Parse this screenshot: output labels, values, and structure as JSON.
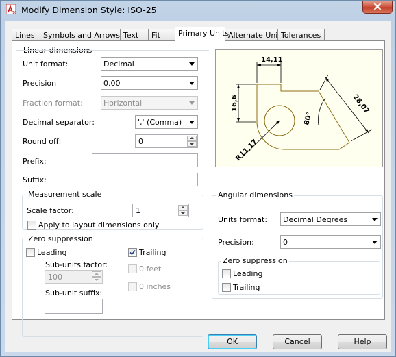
{
  "window": {
    "title": "Modify Dimension Style: ISO-25"
  },
  "tabs": [
    {
      "label": "Lines",
      "active": false
    },
    {
      "label": "Symbols and Arrows",
      "active": false
    },
    {
      "label": "Text",
      "active": false
    },
    {
      "label": "Fit",
      "active": false
    },
    {
      "label": "Primary Units",
      "active": true
    },
    {
      "label": "Alternate Units",
      "active": false
    },
    {
      "label": "Tolerances",
      "active": false
    }
  ],
  "linear": {
    "legend": "Linear dimensions",
    "unit_format": {
      "label": "Unit format:",
      "value": "Decimal"
    },
    "precision": {
      "label": "Precision",
      "value": "0.00"
    },
    "fraction_format": {
      "label": "Fraction format:",
      "value": "Horizontal",
      "disabled": true
    },
    "decimal_separator": {
      "label": "Decimal separator:",
      "value": "',' (Comma)"
    },
    "round_off": {
      "label": "Round off:",
      "value": "0"
    },
    "prefix": {
      "label": "Prefix:",
      "value": ""
    },
    "suffix": {
      "label": "Suffix:",
      "value": ""
    }
  },
  "measurement": {
    "legend": "Measurement scale",
    "scale_factor": {
      "label": "Scale factor:",
      "value": "1"
    },
    "apply_layout": {
      "label": "Apply to layout dimensions only",
      "checked": false
    }
  },
  "zero_suppression": {
    "legend": "Zero suppression",
    "leading": {
      "label": "Leading",
      "checked": false
    },
    "trailing": {
      "label": "Trailing",
      "checked": true
    },
    "sub_units_factor": {
      "label": "Sub-units factor:",
      "value": "100"
    },
    "sub_unit_suffix": {
      "label": "Sub-unit suffix:",
      "value": ""
    },
    "zero_feet": {
      "label": "0 feet",
      "checked": false
    },
    "zero_inches": {
      "label": "0 inches",
      "checked": false
    }
  },
  "preview": {
    "dim_top": "14,11",
    "dim_left": "16,6",
    "dim_right": "28,07",
    "dim_angle": "80°",
    "dim_radius": "R11,17"
  },
  "angular": {
    "legend": "Angular dimensions",
    "units_format": {
      "label": "Units format:",
      "value": "Decimal Degrees"
    },
    "precision": {
      "label": "Precision:",
      "value": "0"
    },
    "zero_legend": "Zero suppression",
    "leading": {
      "label": "Leading",
      "checked": false
    },
    "trailing": {
      "label": "Trailing",
      "checked": false
    }
  },
  "buttons": {
    "ok": "OK",
    "cancel": "Cancel",
    "help": "Help"
  },
  "colors": {
    "preview_bg": "#fffff0",
    "preview_geometry": "#8b6d14",
    "accent": "#3c7fb1"
  }
}
